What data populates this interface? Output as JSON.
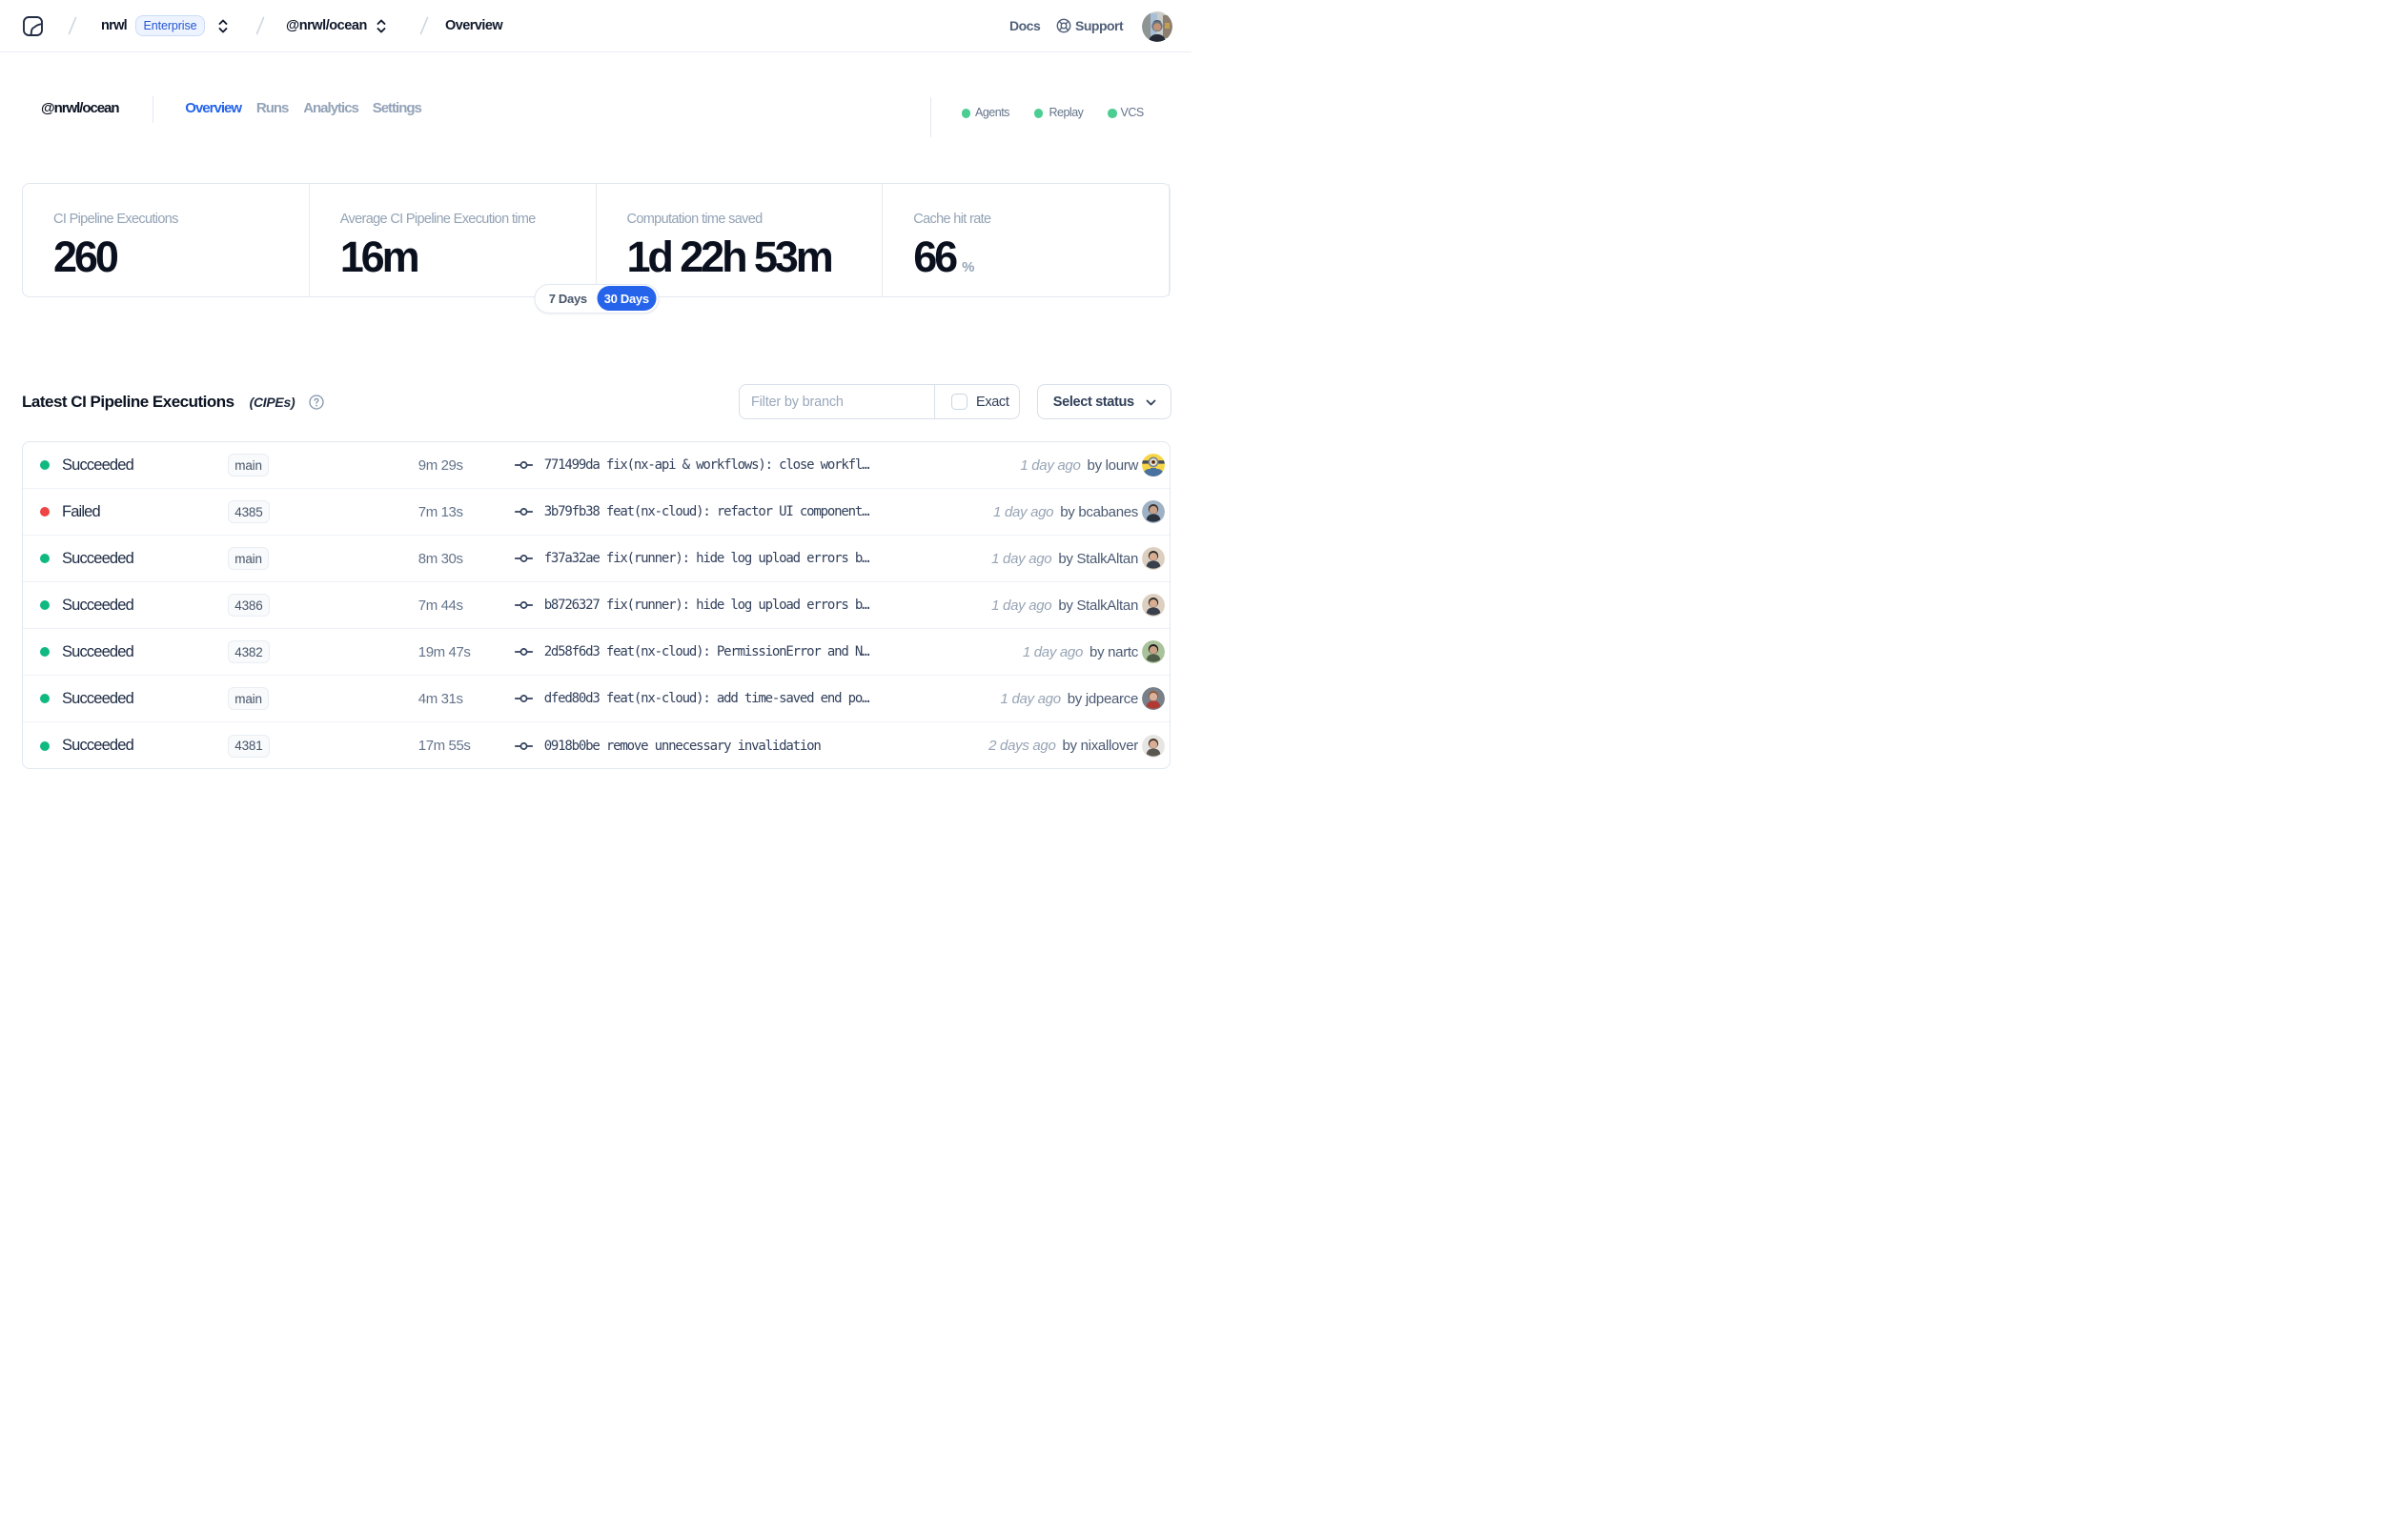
{
  "header": {
    "logo": "nx-cloud-logo",
    "breadcrumb": {
      "separator": "/",
      "org": "nrwl",
      "org_badge": "Enterprise",
      "workspace": "@nrwl/ocean",
      "page": "Overview"
    },
    "links": {
      "docs": "Docs",
      "support": "Support"
    },
    "user_avatar": "user-profile-photo"
  },
  "workspace_bar": {
    "title": "@nrwl/ocean",
    "tabs": [
      {
        "label": "Overview",
        "active": true
      },
      {
        "label": "Runs",
        "active": false
      },
      {
        "label": "Analytics",
        "active": false
      },
      {
        "label": "Settings",
        "active": false
      }
    ],
    "services": [
      {
        "label": "Agents",
        "status_color": "#43ce8c"
      },
      {
        "label": "Replay",
        "status_color": "#43ce8c"
      },
      {
        "label": "VCS",
        "status_color": "#43ce8c"
      }
    ]
  },
  "stats": {
    "cards": [
      {
        "label": "CI Pipeline Executions",
        "value": "260",
        "unit": ""
      },
      {
        "label": "Average CI Pipeline Execution time",
        "value": "16m",
        "unit": ""
      },
      {
        "label": "Computation time saved",
        "value": "1d 22h 53m",
        "unit": ""
      },
      {
        "label": "Cache hit rate",
        "value": "66",
        "unit": "%"
      }
    ],
    "range_toggle": {
      "options": [
        "7 Days",
        "30 Days"
      ],
      "selected": "30 Days"
    }
  },
  "executions": {
    "title": "Latest CI Pipeline Executions",
    "title_suffix": "(CIPEs)",
    "help_icon": "question-mark-circle",
    "filter": {
      "branch_placeholder": "Filter by branch",
      "exact_label": "Exact",
      "exact_checked": false,
      "status_dropdown_label": "Select status"
    },
    "rows": [
      {
        "status": "Succeeded",
        "status_color": "green",
        "branch": "main",
        "duration": "9m 29s",
        "commit": "771499da fix(nx-api & workflows): close workfl…",
        "time_ago": "1 day ago",
        "author": "by lourw",
        "avatar": "lourw"
      },
      {
        "status": "Failed",
        "status_color": "red",
        "branch": "4385",
        "duration": "7m 13s",
        "commit": "3b79fb38 feat(nx-cloud): refactor UI component…",
        "time_ago": "1 day ago",
        "author": "by bcabanes",
        "avatar": "bcabanes"
      },
      {
        "status": "Succeeded",
        "status_color": "green",
        "branch": "main",
        "duration": "8m 30s",
        "commit": "f37a32ae fix(runner): hide log upload errors b…",
        "time_ago": "1 day ago",
        "author": "by StalkAltan",
        "avatar": "stalkaltan"
      },
      {
        "status": "Succeeded",
        "status_color": "green",
        "branch": "4386",
        "duration": "7m 44s",
        "commit": "b8726327 fix(runner): hide log upload errors b…",
        "time_ago": "1 day ago",
        "author": "by StalkAltan",
        "avatar": "stalkaltan"
      },
      {
        "status": "Succeeded",
        "status_color": "green",
        "branch": "4382",
        "duration": "19m 47s",
        "commit": "2d58f6d3 feat(nx-cloud): PermissionError and N…",
        "time_ago": "1 day ago",
        "author": "by nartc",
        "avatar": "nartc"
      },
      {
        "status": "Succeeded",
        "status_color": "green",
        "branch": "main",
        "duration": "4m 31s",
        "commit": "dfed80d3 feat(nx-cloud): add time-saved end po…",
        "time_ago": "1 day ago",
        "author": "by jdpearce",
        "avatar": "jdpearce"
      },
      {
        "status": "Succeeded",
        "status_color": "green",
        "branch": "4381",
        "duration": "17m 55s",
        "commit": "0918b0be remove unnecessary invalidation",
        "time_ago": "2 days ago",
        "author": "by nixallover",
        "avatar": "nixallover"
      }
    ]
  },
  "avatar_palettes": {
    "lourw": {
      "bg": "#f7d544",
      "head": "#f7d544",
      "body": "#4a72a0",
      "hair": "none",
      "minion": true
    },
    "bcabanes": {
      "bg": "#9fb2c4",
      "head": "#c9a189",
      "body": "#2b3340",
      "hair": "#3a332e",
      "minion": false
    },
    "stalkaltan": {
      "bg": "#dccfc0",
      "head": "#d9ad92",
      "body": "#39404c",
      "hair": "#2e2a27",
      "minion": false
    },
    "nartc": {
      "bg": "#a9c29b",
      "head": "#c9a185",
      "body": "#4f5e49",
      "hair": "#1f1b18",
      "minion": false
    },
    "jdpearce": {
      "bg": "#7a8089",
      "head": "#dab29c",
      "body": "#b03a31",
      "hair": "#8a5b3a",
      "minion": false
    },
    "nixallover": {
      "bg": "#e7e5e1",
      "head": "#d9ae94",
      "body": "#5a5750",
      "hair": "#42332b",
      "minion": false
    }
  }
}
